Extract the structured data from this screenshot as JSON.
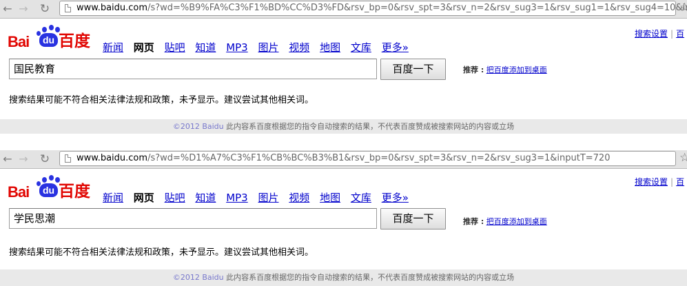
{
  "panels": [
    {
      "url_host": "www.baidu.com",
      "url_path": "/s?wd=%B9%FA%C3%F1%BD%CC%D3%FD&rsv_bp=0&rsv_spt=3&rsv_n=2&rsv_sug3=1&rsv_sug1=1&rsv_sug4=10&input...",
      "logo": {
        "bai": "Bai",
        "du": "du",
        "cn": "百度"
      },
      "tabs": [
        {
          "label": "新闻"
        },
        {
          "label": "网页"
        },
        {
          "label": "贴吧"
        },
        {
          "label": "知道"
        },
        {
          "label": "MP3"
        },
        {
          "label": "图片"
        },
        {
          "label": "视频"
        },
        {
          "label": "地图"
        },
        {
          "label": "文库"
        },
        {
          "label": "更多»"
        }
      ],
      "top_links": {
        "settings": "搜索设置",
        "separator": "|",
        "partial": "百"
      },
      "search": {
        "value": "国民教育",
        "button": "百度一下"
      },
      "recommend": {
        "label": "推荐 :",
        "link": "把百度添加到桌面"
      },
      "notice": "搜索结果可能不符合相关法律法规和政策，未予显示。建议尝试其他相关词。",
      "footer": {
        "copyright": "©2012 Baidu",
        "text": "此内容系百度根据您的指令自动搜索的结果，不代表百度赞成被搜索网站的内容或立场"
      }
    },
    {
      "url_host": "www.baidu.com",
      "url_path": "/s?wd=%D1%A7%C3%F1%CB%BC%B3%B1&rsv_bp=0&rsv_spt=3&rsv_n=2&rsv_sug3=1&inputT=720",
      "logo": {
        "bai": "Bai",
        "du": "du",
        "cn": "百度"
      },
      "tabs": [
        {
          "label": "新闻"
        },
        {
          "label": "网页"
        },
        {
          "label": "贴吧"
        },
        {
          "label": "知道"
        },
        {
          "label": "MP3"
        },
        {
          "label": "图片"
        },
        {
          "label": "视频"
        },
        {
          "label": "地图"
        },
        {
          "label": "文库"
        },
        {
          "label": "更多»"
        }
      ],
      "top_links": {
        "settings": "搜索设置",
        "separator": "|",
        "partial": "百"
      },
      "search": {
        "value": "学民思潮",
        "button": "百度一下"
      },
      "recommend": {
        "label": "推荐 :",
        "link": "把百度添加到桌面"
      },
      "notice": "搜索结果可能不符合相关法律法规和政策，未予显示。建议尝试其他相关词。",
      "footer": {
        "copyright": "©2012 Baidu",
        "text": "此内容系百度根据您的指令自动搜索的结果，不代表百度赞成被搜索网站的内容或立场"
      }
    }
  ],
  "icons": {
    "back": "back-arrow-icon",
    "forward": "forward-arrow-icon",
    "reload": "reload-icon",
    "page": "page-icon",
    "bookmark": "bookmark-star-icon"
  },
  "colors": {
    "link": "#0000cc",
    "brand_red": "#e10602",
    "brand_blue": "#2932e1",
    "footer_bg": "#e9e9e9"
  }
}
